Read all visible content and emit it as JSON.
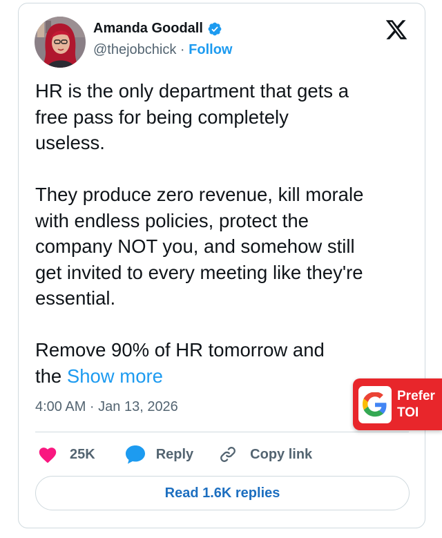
{
  "author": {
    "name": "Amanda Goodall",
    "handle": "@thejobchick",
    "separator": " · ",
    "follow_label": "Follow"
  },
  "icons": {
    "verified": "verified-badge-icon",
    "platform": "x-logo-icon",
    "like": "heart-icon",
    "reply": "speech-bubble-icon",
    "copy": "link-icon",
    "badge": "google-g-icon"
  },
  "tweet": {
    "body": "HR is the only department that gets a\nfree pass for being completely\nuseless.\n\nThey produce zero revenue, kill morale\nwith endless policies, protect the\ncompany NOT you, and somehow still\nget invited to every meeting like they're\nessential.\n\nRemove 90% of HR tomorrow and\nthe ",
    "show_more": "Show more",
    "timestamp": "4:00 AM · Jan 13, 2026"
  },
  "actions": {
    "likes": "25K",
    "reply": "Reply",
    "copy_link": "Copy link"
  },
  "read_replies": "Read 1.6K replies",
  "badge": {
    "text": "Prefer\nTOI"
  },
  "colors": {
    "accent": "#1d9bf0",
    "heart": "#f91880",
    "badge_red": "#e8262b",
    "text": "#0f1419",
    "muted": "#536471",
    "border": "#cfd9de"
  }
}
